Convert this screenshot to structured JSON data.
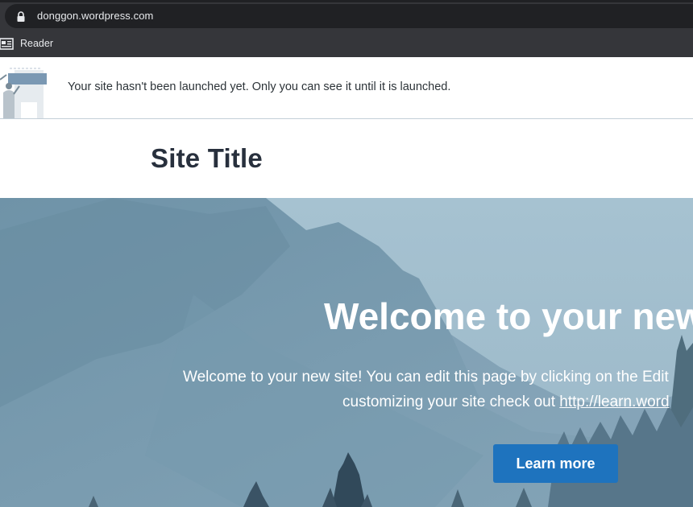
{
  "browser": {
    "url": "donggon.wordpress.com",
    "bookmarks": [
      {
        "label": "Reader",
        "icon": "reader-icon"
      }
    ]
  },
  "notice": {
    "text": "Your site hasn't been launched yet. Only you can see it until it is launched."
  },
  "site": {
    "title": "Site Title"
  },
  "hero": {
    "heading": "Welcome to your new",
    "line1": "Welcome to your new site! You can edit this page by clicking on the Edit",
    "line2_text": "customizing your site check out ",
    "line2_link": "http://learn.word",
    "button_label": "Learn more"
  },
  "colors": {
    "browser_chrome": "#35363a",
    "omnibox": "#202124",
    "button_blue": "#1e73be",
    "hero_tint": "#8eaebf"
  }
}
